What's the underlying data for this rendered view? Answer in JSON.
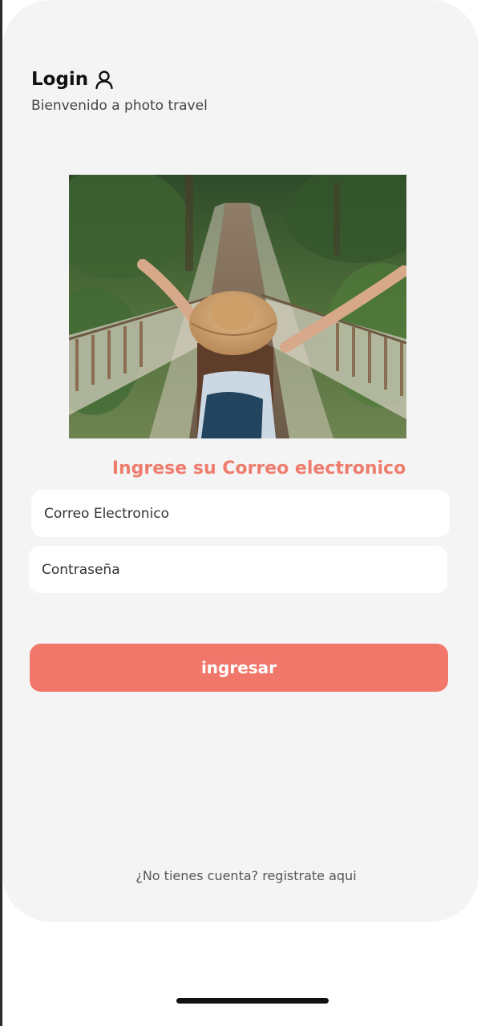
{
  "header": {
    "title": "Login",
    "subtitle": "Bienvenido a photo travel",
    "title_icon": "user-icon"
  },
  "hero_image": {
    "alt": "Mujer con sombrero en un puente colgante"
  },
  "form": {
    "prompt": "Ingrese su Correo electronico",
    "email_placeholder": "Correo Electronico",
    "password_placeholder": "Contraseña",
    "submit_label": "ingresar"
  },
  "footer": {
    "register_text": "¿No tienes cuenta? registrate aqui"
  },
  "colors": {
    "accent": "#f1776a",
    "prompt_text": "#ee7d6e",
    "card_background": "#f5f4f4",
    "field_background": "#ffffff"
  }
}
